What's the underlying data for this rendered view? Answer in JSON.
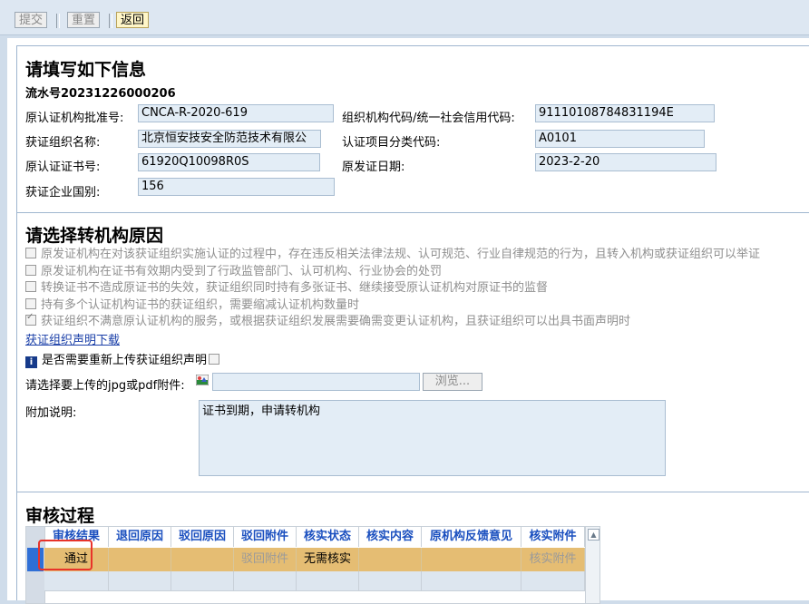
{
  "toolbar": {
    "submit_label": "提交",
    "reset_label": "重置",
    "back_label": "返回"
  },
  "info": {
    "title": "请填写如下信息",
    "serial": "流水号20231226000206",
    "fields": [
      {
        "label": "原认证机构批准号:",
        "value": "CNCA-R-2020-619"
      },
      {
        "label": "组织机构代码/统一社会信用代码:",
        "value": "91110108784831194E"
      },
      {
        "label": "获证组织名称:",
        "value": "北京恒安技安全防范技术有限公"
      },
      {
        "label": "认证项目分类代码:",
        "value": "A0101"
      },
      {
        "label": "原认证证书号:",
        "value": "61920Q10098R0S"
      },
      {
        "label": "原发证日期:",
        "value": "2023-2-20"
      },
      {
        "label": "获证企业国别:",
        "value": "156"
      }
    ]
  },
  "reason": {
    "title": "请选择转机构原因",
    "options": [
      {
        "text": "原发证机构在对该获证组织实施认证的过程中，存在违反相关法律法规、认可规范、行业自律规范的行为，且转入机构或获证组织可以举证",
        "checked": false
      },
      {
        "text": "原发证机构在证书有效期内受到了行政监管部门、认可机构、行业协会的处罚",
        "checked": false
      },
      {
        "text": "转换证书不造成原证书的失效，获证组织同时持有多张证书、继续接受原认证机构对原证书的监督",
        "checked": false
      },
      {
        "text": "持有多个认证机构证书的获证组织，需要缩减认证机构数量时",
        "checked": false
      },
      {
        "text": "获证组织不满意原认证机构的服务，或根据获证组织发展需要确需变更认证机构，且获证组织可以出具书面声明时",
        "checked": true
      }
    ],
    "download_link": "获证组织声明下载",
    "reupload_label": "是否需要重新上传获证组织声明",
    "upload_label": "请选择要上传的jpg或pdf附件:",
    "browse_label": "浏览...",
    "note_label": "附加说明:",
    "note_value": "证书到期，申请转机构"
  },
  "review": {
    "title": "审核过程",
    "columns": [
      "审核结果",
      "退回原因",
      "驳回原因",
      "驳回附件",
      "核实状态",
      "核实内容",
      "原机构反馈意见",
      "核实附件"
    ],
    "rows": [
      [
        "通过",
        "",
        "",
        "驳回附件",
        "无需核实",
        "",
        "",
        "核实附件"
      ]
    ]
  },
  "colors": {
    "selected_row": "#e5bd73",
    "header_text": "#1a4fbf",
    "highlight_box": "#e8332a"
  }
}
